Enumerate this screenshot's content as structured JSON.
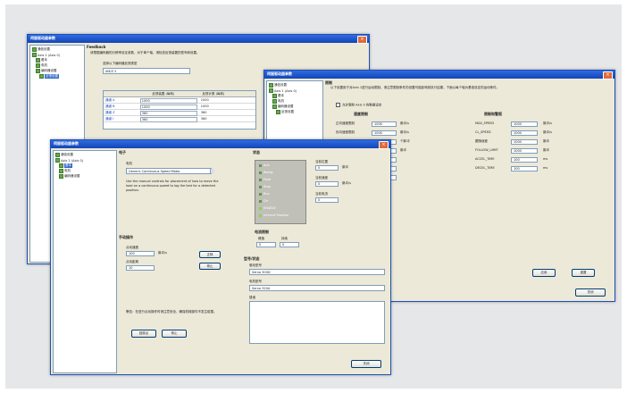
{
  "window_a": {
    "title": "伺服驱动器参数",
    "tree": [
      "通信设置",
      "Axis 1 (Axis 0)",
      "基本",
      "电机",
      "编码器设置",
      "反馈设置"
    ],
    "section": "Feedback",
    "desc": "请根据编码器的分辨率设定参数，对于单个轴，请检查反馈装置的型号和设置。",
    "field_label": "选择以下编码器反馈类型",
    "field_value": "AM/Z 2",
    "table_header": [
      "反馈装置 (每转)",
      "反馈计数 (每转)"
    ],
    "rows": [
      {
        "k": "通道 A",
        "v": "1000",
        "w": "1000"
      },
      {
        "k": "通道 B",
        "v": "1000",
        "w": "1000"
      },
      {
        "k": "通道 Z",
        "v": "360",
        "w": "360"
      },
      {
        "k": "通道 I",
        "v": "360",
        "w": "360"
      }
    ]
  },
  "window_b": {
    "title": "伺服驱动器参数",
    "tree": [
      "通信设置",
      "Axis 1 (Axis 0)",
      "基本",
      "电机",
      "编码器设置",
      "反馈设置"
    ],
    "section": "限制",
    "desc": "以下设置用于对Axis 1进行运动限制，请注意限制条件的设置可能影响到执行结果，下面以每个轴为基准设定的运动条件。",
    "checkbox": "允许限制 Axis 0 的数据设定",
    "left_header": "速度限制",
    "right_header": "限制和警报",
    "left_rows": [
      {
        "k": "正向速度限制",
        "v": "1000",
        "u": "脉冲/s"
      },
      {
        "k": "负向速度限制",
        "v": "1000",
        "u": "脉冲/s"
      },
      {
        "k": "加速度限制",
        "v": "10",
        "u": "个脉冲"
      },
      {
        "k": "减速度限制",
        "v": "10",
        "u": "脉冲"
      },
      {
        "k": "正向限位",
        "v": "0",
        "u": ""
      },
      {
        "k": "负向限位",
        "v": "0",
        "u": ""
      },
      {
        "k": "原点",
        "v": "0",
        "u": ""
      }
    ],
    "right_rows": [
      {
        "k": "MAX_SPEED",
        "v": "1000",
        "u": "脉冲/s"
      },
      {
        "k": "CL_SPEED",
        "v": "1000",
        "u": "脉冲/s"
      },
      {
        "k": "跟随误差",
        "v": "1000",
        "u": "脉冲"
      },
      {
        "k": "FOLLOW_LIMIT",
        "v": "1000",
        "u": "脉冲"
      },
      {
        "k": "ACCEL_TIME",
        "v": "100",
        "u": "ms"
      },
      {
        "k": "DECEL_TIME",
        "v": "100",
        "u": "ms"
      }
    ],
    "apply": "应用",
    "reset": "重置",
    "close": "关闭"
  },
  "window_c": {
    "title": "伺服驱动器参数",
    "tree": [
      "通信设置",
      "Axis 1 (Axis 0)",
      "基本",
      "电机",
      "编码器设置"
    ],
    "sec_motor": "电子",
    "sec_status": "状态",
    "motor_label": "电机",
    "motor_value": "Generic Continuous Speed Motor",
    "motor_desc": "Use the manual controls for placement of how to move the load on a continuous speed to log the test for a detected position.",
    "mini_list": [
      "Aux",
      "Ready",
      "Fault",
      "Stop",
      "Run",
      "Dir",
      "ENABLE",
      "Internal Position"
    ],
    "status_fields": [
      {
        "k": "当前位置",
        "v": "0",
        "u": "脉冲"
      },
      {
        "k": "当前速度",
        "v": "0",
        "u": "脉冲/s"
      },
      {
        "k": "当前电流",
        "v": "0",
        "u": ""
      }
    ],
    "jog_header": "手动操作",
    "jog_speed_label": "点动速度",
    "jog_speed": "100",
    "jog_speed_unit": "脉冲/s",
    "jog_step_label": "点动距离",
    "jog_step": "10",
    "jog_fwd": "正转",
    "jog_rev": "停止",
    "elec_header": "电流限制",
    "elec_cols": [
      "峰值",
      "持续"
    ],
    "elec_vals": [
      "0",
      "0"
    ],
    "info_header": "型号/状态",
    "info_fields": [
      {
        "k": "驱动型号",
        "v": "Servo 300D"
      },
      {
        "k": "电机型号",
        "v": "Servo 320A"
      },
      {
        "k": "错误",
        "v": ""
      }
    ],
    "note": "警告：在进行点动操作时请注意安全，确保机械部件不发生碰撞。",
    "btn_home": "回原点",
    "btn_stop": "停止",
    "close": "关闭"
  }
}
